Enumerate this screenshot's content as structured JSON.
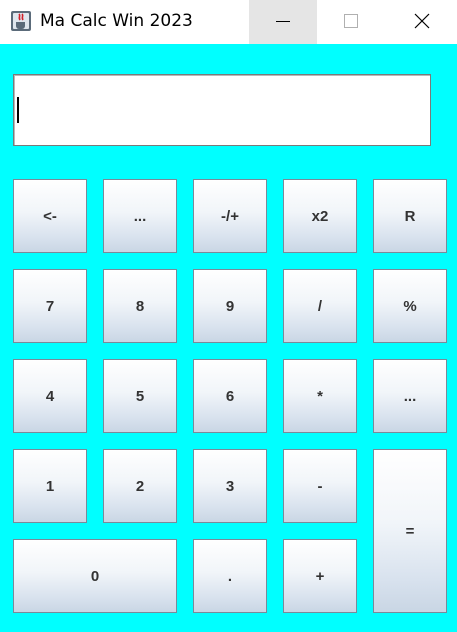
{
  "window": {
    "title": "Ma Calc Win 2023",
    "icon": "java-cup-icon"
  },
  "display": {
    "value": ""
  },
  "keys": {
    "backspace": "<-",
    "dots1": "...",
    "negate": "-/+",
    "square": "x2",
    "root": "R",
    "seven": "7",
    "eight": "8",
    "nine": "9",
    "divide": "/",
    "percent": "%",
    "four": "4",
    "five": "5",
    "six": "6",
    "multiply": "*",
    "dots2": "...",
    "one": "1",
    "two": "2",
    "three": "3",
    "minus": "-",
    "equals": "=",
    "zero": "0",
    "decimal": ".",
    "plus": "+"
  },
  "colors": {
    "background": "#00ffff",
    "button_top": "#ffffff",
    "button_bottom": "#c9d6e4"
  }
}
